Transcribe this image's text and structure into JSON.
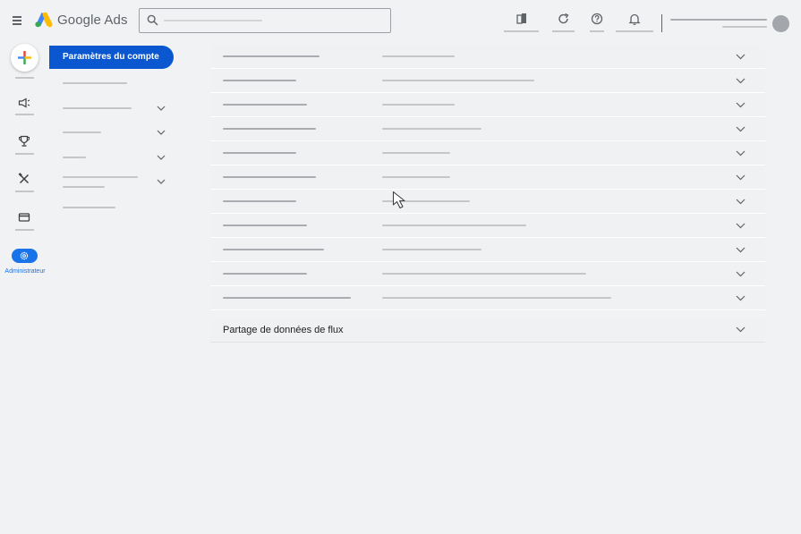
{
  "header": {
    "brand": "Google Ads",
    "search": {
      "value": "",
      "placeholder": ""
    },
    "icons": [
      "menu-icon",
      "search-icon",
      "appearance-icon",
      "refresh-icon",
      "help-icon",
      "notifications-icon"
    ]
  },
  "rail": {
    "create_icon": "plus-icon",
    "items": [
      "campaigns-icon",
      "goals-icon",
      "tools-icon",
      "billing-icon"
    ],
    "admin_label": "Administrateur"
  },
  "subnav": {
    "active_label": "Paramètres du compte"
  },
  "main": {
    "rows_count_visible": 11,
    "feed_section_title": "Partage de données de flux"
  },
  "colors": {
    "accent": "#0b57d0",
    "admin_accent": "#1a73e8",
    "background": "#f1f2f3"
  }
}
